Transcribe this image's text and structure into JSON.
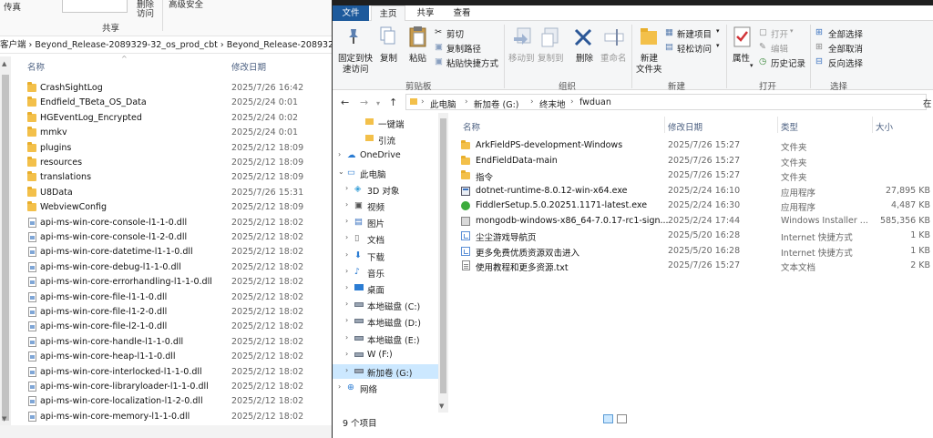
{
  "left_window": {
    "ribbon": {
      "pass_label": "传真",
      "delete_access_top": "删除",
      "delete_access_bottom": "访问",
      "advanced_security": "高级安全",
      "group_share": "共享"
    },
    "address": "客户端 › Beyond_Release-2089329-32_os_prod_cbt › Beyond_Release-2089329-3",
    "columns": {
      "name": "名称",
      "modified": "修改日期"
    },
    "rows": [
      {
        "name": "CrashSightLog",
        "date": "2025/7/26 16:42",
        "kind": "folder"
      },
      {
        "name": "Endfield_TBeta_OS_Data",
        "date": "2025/2/24 0:01",
        "kind": "folder"
      },
      {
        "name": "HGEventLog_Encrypted",
        "date": "2025/2/24 0:02",
        "kind": "folder"
      },
      {
        "name": "mmkv",
        "date": "2025/2/24 0:01",
        "kind": "folder"
      },
      {
        "name": "plugins",
        "date": "2025/2/12 18:09",
        "kind": "folder"
      },
      {
        "name": "resources",
        "date": "2025/2/12 18:09",
        "kind": "folder"
      },
      {
        "name": "translations",
        "date": "2025/2/12 18:09",
        "kind": "folder"
      },
      {
        "name": "U8Data",
        "date": "2025/7/26 15:31",
        "kind": "folder"
      },
      {
        "name": "WebviewConfig",
        "date": "2025/2/12 18:09",
        "kind": "folder"
      },
      {
        "name": "api-ms-win-core-console-l1-1-0.dll",
        "date": "2025/2/12 18:02",
        "kind": "dll"
      },
      {
        "name": "api-ms-win-core-console-l1-2-0.dll",
        "date": "2025/2/12 18:02",
        "kind": "dll"
      },
      {
        "name": "api-ms-win-core-datetime-l1-1-0.dll",
        "date": "2025/2/12 18:02",
        "kind": "dll"
      },
      {
        "name": "api-ms-win-core-debug-l1-1-0.dll",
        "date": "2025/2/12 18:02",
        "kind": "dll"
      },
      {
        "name": "api-ms-win-core-errorhandling-l1-1-0.dll",
        "date": "2025/2/12 18:02",
        "kind": "dll"
      },
      {
        "name": "api-ms-win-core-file-l1-1-0.dll",
        "date": "2025/2/12 18:02",
        "kind": "dll"
      },
      {
        "name": "api-ms-win-core-file-l1-2-0.dll",
        "date": "2025/2/12 18:02",
        "kind": "dll"
      },
      {
        "name": "api-ms-win-core-file-l2-1-0.dll",
        "date": "2025/2/12 18:02",
        "kind": "dll"
      },
      {
        "name": "api-ms-win-core-handle-l1-1-0.dll",
        "date": "2025/2/12 18:02",
        "kind": "dll"
      },
      {
        "name": "api-ms-win-core-heap-l1-1-0.dll",
        "date": "2025/2/12 18:02",
        "kind": "dll"
      },
      {
        "name": "api-ms-win-core-interlocked-l1-1-0.dll",
        "date": "2025/2/12 18:02",
        "kind": "dll"
      },
      {
        "name": "api-ms-win-core-libraryloader-l1-1-0.dll",
        "date": "2025/2/12 18:02",
        "kind": "dll"
      },
      {
        "name": "api-ms-win-core-localization-l1-2-0.dll",
        "date": "2025/2/12 18:02",
        "kind": "dll"
      },
      {
        "name": "api-ms-win-core-memory-l1-1-0.dll",
        "date": "2025/2/12 18:02",
        "kind": "dll"
      }
    ]
  },
  "right_window": {
    "tabs": [
      "文件",
      "主页",
      "共享",
      "查看"
    ],
    "ribbon": {
      "pin_quick_access_1": "固定到快",
      "pin_quick_access_2": "速访问",
      "copy": "复制",
      "paste": "粘贴",
      "cut": "剪切",
      "copy_path": "复制路径",
      "paste_shortcut": "粘贴快捷方式",
      "move_to": "移动到",
      "copy_to": "复制到",
      "delete": "删除",
      "rename": "重命名",
      "new_folder_1": "新建",
      "new_folder_2": "文件夹",
      "new_item": "新建项目",
      "easy_access": "轻松访问",
      "properties": "属性",
      "open": "打开",
      "edit": "编辑",
      "history": "历史记录",
      "select_all": "全部选择",
      "select_none": "全部取消",
      "invert_selection": "反向选择",
      "group_clipboard": "剪贴板",
      "group_organize": "组织",
      "group_new": "新建",
      "group_open": "打开",
      "group_select": "选择"
    },
    "breadcrumb": [
      "此电脑",
      "新加卷 (G:)",
      "终末地",
      "fwduan"
    ],
    "search_hint": "在",
    "nav": [
      {
        "label": "一键端",
        "level": 2,
        "kind": "folder"
      },
      {
        "label": "引流",
        "level": 2,
        "kind": "folder"
      },
      {
        "label": "OneDrive",
        "level": 0,
        "kind": "cloud"
      },
      {
        "label": "此电脑",
        "level": 0,
        "kind": "pc",
        "expanded": true
      },
      {
        "label": "3D 对象",
        "level": 1,
        "kind": "3d"
      },
      {
        "label": "视频",
        "level": 1,
        "kind": "video"
      },
      {
        "label": "图片",
        "level": 1,
        "kind": "pic"
      },
      {
        "label": "文档",
        "level": 1,
        "kind": "doc"
      },
      {
        "label": "下载",
        "level": 1,
        "kind": "down"
      },
      {
        "label": "音乐",
        "level": 1,
        "kind": "music"
      },
      {
        "label": "桌面",
        "level": 1,
        "kind": "desk"
      },
      {
        "label": "本地磁盘 (C:)",
        "level": 1,
        "kind": "drive"
      },
      {
        "label": "本地磁盘 (D:)",
        "level": 1,
        "kind": "drive"
      },
      {
        "label": "本地磁盘 (E:)",
        "level": 1,
        "kind": "drive"
      },
      {
        "label": "W (F:)",
        "level": 1,
        "kind": "drive"
      },
      {
        "label": "新加卷 (G:)",
        "level": 1,
        "kind": "drive",
        "selected": true
      },
      {
        "label": "网络",
        "level": 0,
        "kind": "net"
      }
    ],
    "columns": {
      "name": "名称",
      "modified": "修改日期",
      "type": "类型",
      "size": "大小"
    },
    "files": [
      {
        "name": "ArkFieldPS-development-Windows",
        "date": "2025/7/26 15:27",
        "type": "文件夹",
        "size": "",
        "kind": "folder"
      },
      {
        "name": "EndFieldData-main",
        "date": "2025/7/26 15:27",
        "type": "文件夹",
        "size": "",
        "kind": "folder"
      },
      {
        "name": "指令",
        "date": "2025/7/26 15:27",
        "type": "文件夹",
        "size": "",
        "kind": "folder"
      },
      {
        "name": "dotnet-runtime-8.0.12-win-x64.exe",
        "date": "2025/2/24 16:10",
        "type": "应用程序",
        "size": "27,895 KB",
        "kind": "exe"
      },
      {
        "name": "FiddlerSetup.5.0.20251.1171-latest.exe",
        "date": "2025/2/24 16:30",
        "type": "应用程序",
        "size": "4,487 KB",
        "kind": "fiddler"
      },
      {
        "name": "mongodb-windows-x86_64-7.0.17-rc1-sign...",
        "date": "2025/2/24 17:44",
        "type": "Windows Installer ...",
        "size": "585,356 KB",
        "kind": "msi"
      },
      {
        "name": "尘尘游戏导航页",
        "date": "2025/5/20 16:28",
        "type": "Internet 快捷方式",
        "size": "1 KB",
        "kind": "lnk"
      },
      {
        "name": "更多免费优质资源双击进入",
        "date": "2025/5/20 16:28",
        "type": "Internet 快捷方式",
        "size": "1 KB",
        "kind": "lnk"
      },
      {
        "name": "使用教程和更多资源.txt",
        "date": "2025/7/26 15:27",
        "type": "文本文档",
        "size": "2 KB",
        "kind": "txt"
      }
    ],
    "status": "9 个项目"
  }
}
